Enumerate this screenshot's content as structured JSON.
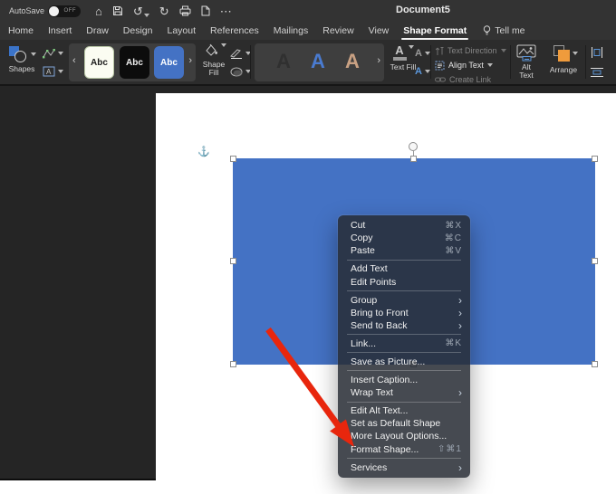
{
  "window": {
    "title": "Document5"
  },
  "titlebar": {
    "autosave_label": "AutoSave",
    "autosave_state": "OFF"
  },
  "glyphs": {
    "home": "⌂",
    "undo": "↺",
    "redo": "↻",
    "ellipsis": "⋯",
    "gallery_prev": "‹",
    "gallery_next": "›",
    "submenu_arrow": "›",
    "anchor": "⚓",
    "wordart_letter": "A",
    "textfill_letter": "A"
  },
  "tabs": {
    "items": [
      {
        "label": "Home"
      },
      {
        "label": "Insert"
      },
      {
        "label": "Draw"
      },
      {
        "label": "Design"
      },
      {
        "label": "Layout"
      },
      {
        "label": "References"
      },
      {
        "label": "Mailings"
      },
      {
        "label": "Review"
      },
      {
        "label": "View"
      },
      {
        "label": "Shape Format",
        "active": true
      }
    ],
    "tell_me": "Tell me"
  },
  "ribbon": {
    "shapes_label": "Shapes",
    "style_gallery": [
      "Abc",
      "Abc",
      "Abc"
    ],
    "shape_fill_label": "Shape Fill",
    "text_fill_label": "Text Fill",
    "text_direction_label": "Text Direction",
    "align_text_label": "Align Text",
    "create_link_label": "Create Link",
    "alt_text_label": "Alt Text",
    "arrange_label": "Arrange"
  },
  "canvas": {
    "shape_color": "#4472C4"
  },
  "context_menu": {
    "items": [
      {
        "label": "Cut",
        "shortcut": "⌘X"
      },
      {
        "label": "Copy",
        "shortcut": "⌘C"
      },
      {
        "label": "Paste",
        "shortcut": "⌘V"
      },
      {
        "label": "Add Text"
      },
      {
        "label": "Edit Points"
      },
      {
        "label": "Group"
      },
      {
        "label": "Bring to Front"
      },
      {
        "label": "Send to Back"
      },
      {
        "label": "Link...",
        "shortcut": "⌘K"
      },
      {
        "label": "Save as Picture..."
      },
      {
        "label": "Insert Caption..."
      },
      {
        "label": "Wrap Text"
      },
      {
        "label": "Edit Alt Text..."
      },
      {
        "label": "Set as Default Shape"
      },
      {
        "label": "More Layout Options..."
      },
      {
        "label": "Format Shape...",
        "shortcut": "⇧⌘1"
      },
      {
        "label": "Services"
      }
    ]
  },
  "annotation": {
    "arrow_color": "#E8260D"
  }
}
